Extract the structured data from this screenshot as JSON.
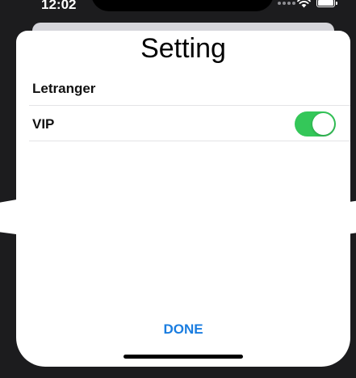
{
  "status_bar": {
    "time": "12:02",
    "icons": [
      "signal-dots-icon",
      "wifi-icon",
      "battery-icon"
    ]
  },
  "sheet": {
    "title": "Setting",
    "rows": [
      {
        "label": "Letranger"
      },
      {
        "label": "VIP",
        "toggle_on": true
      }
    ],
    "done_label": "DONE"
  },
  "colors": {
    "toggle_on": "#34c759",
    "done_text": "#1a7de0",
    "frame": "#1c1c1e"
  }
}
